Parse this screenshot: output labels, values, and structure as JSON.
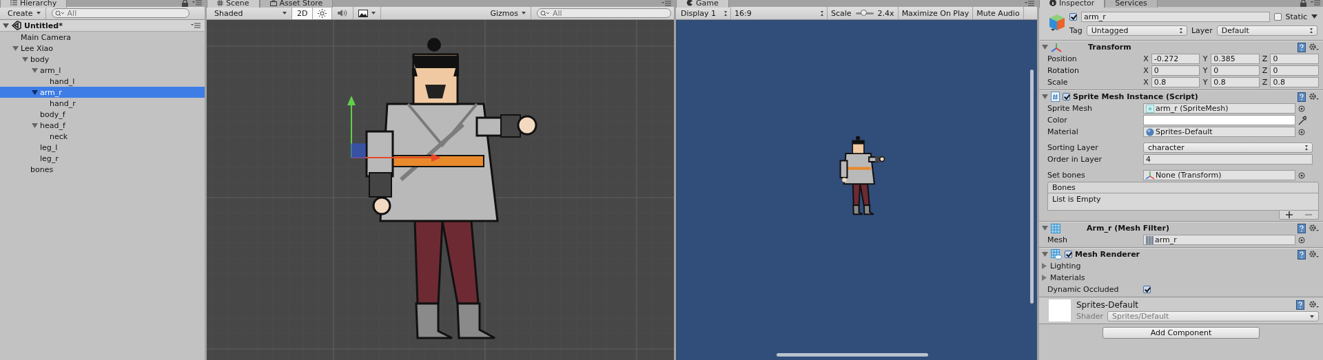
{
  "hierarchy": {
    "tab": "Hierarchy",
    "create_button": "Create",
    "search_placeholder": "All",
    "scene": {
      "name": "Untitled*",
      "expanded": true
    },
    "items": [
      {
        "name": "Main Camera",
        "selected": false
      },
      {
        "name": "Lee Xiao",
        "expanded": true,
        "selected": false,
        "children": [
          {
            "name": "body",
            "expanded": true,
            "selected": false,
            "children": [
              {
                "name": "arm_l",
                "expanded": true,
                "selected": false,
                "children": [
                  {
                    "name": "hand_l",
                    "selected": false
                  }
                ]
              },
              {
                "name": "arm_r",
                "expanded": true,
                "selected": true,
                "children": [
                  {
                    "name": "hand_r",
                    "selected": false
                  }
                ]
              },
              {
                "name": "body_f",
                "selected": false
              },
              {
                "name": "head_f",
                "expanded": true,
                "selected": false,
                "children": [
                  {
                    "name": "neck",
                    "selected": false
                  }
                ]
              },
              {
                "name": "leg_l",
                "selected": false
              },
              {
                "name": "leg_r",
                "selected": false
              }
            ]
          },
          {
            "name": "bones",
            "selected": false
          }
        ]
      }
    ]
  },
  "scene_view": {
    "tabs": [
      {
        "label": "Scene",
        "selected": true
      },
      {
        "label": "Asset Store",
        "selected": false
      }
    ],
    "shading": "Shaded",
    "mode_2d": {
      "label": "2D",
      "on": true
    },
    "lighting": {
      "on": true
    },
    "audio": {
      "on": false
    },
    "gizmos": "Gizmos",
    "search_placeholder": "All"
  },
  "game_view": {
    "tab": "Game",
    "display": "Display 1",
    "aspect": "16:9",
    "scale_label": "Scale",
    "scale": {
      "level": 0.45
    },
    "scale_reading": "2.4x",
    "maximize": "Maximize On Play",
    "mute": "Mute Audio"
  },
  "inspector": {
    "tabs": [
      {
        "label": "Inspector",
        "selected": true
      },
      {
        "label": "Services",
        "selected": false
      }
    ],
    "object": {
      "active": true,
      "name": "arm_r",
      "static_label": "Static",
      "static": false,
      "tag_label": "Tag",
      "tag": "Untagged",
      "layer_label": "Layer",
      "layer": "Default"
    },
    "components": [
      {
        "kind": "transform",
        "title": "Transform",
        "expanded": true,
        "sections": [
          [
            {
              "kind": "vector3",
              "label": "Position",
              "values": [
                {
                  "axis": "X",
                  "value": "-0.272"
                },
                {
                  "axis": "Y",
                  "value": "0.385"
                },
                {
                  "axis": "Z",
                  "value": "0"
                }
              ]
            },
            {
              "kind": "vector3",
              "label": "Rotation",
              "values": [
                {
                  "axis": "X",
                  "value": "0"
                },
                {
                  "axis": "Y",
                  "value": "0"
                },
                {
                  "axis": "Z",
                  "value": "0"
                }
              ]
            },
            {
              "kind": "vector3",
              "label": "Scale",
              "values": [
                {
                  "axis": "X",
                  "value": "0.8"
                },
                {
                  "axis": "Y",
                  "value": "0.8"
                },
                {
                  "axis": "Z",
                  "value": "0.8"
                }
              ]
            }
          ]
        ]
      },
      {
        "kind": "script",
        "title": "Sprite Mesh Instance (Script)",
        "enabled": true,
        "expanded": true,
        "sections": [
          [
            {
              "kind": "spritemesh",
              "label": "Sprite Mesh",
              "value": "arm_r (SpriteMesh)"
            },
            {
              "kind": "color",
              "label": "Color"
            },
            {
              "kind": "material",
              "label": "Material",
              "value": "Sprites-Default"
            }
          ],
          [
            {
              "kind": "dropdown",
              "label": "Sorting Layer",
              "value": "character"
            },
            {
              "kind": "text",
              "label": "Order in Layer",
              "value": "4"
            }
          ],
          [
            {
              "kind": "transform",
              "label": "Set bones",
              "value": "None (Transform)"
            },
            {
              "kind": "list",
              "label": "Bones",
              "value": "List is Empty"
            }
          ]
        ]
      },
      {
        "kind": "mesh_filter",
        "title": "Arm_r (Mesh Filter)",
        "expanded": true,
        "sections": [
          [
            {
              "kind": "mesh",
              "label": "Mesh",
              "value": "arm_r"
            }
          ]
        ]
      },
      {
        "kind": "mesh_renderer",
        "title": "Mesh Renderer",
        "enabled": true,
        "expanded": true,
        "sections": [
          [
            {
              "kind": "foldout",
              "label": "Lighting",
              "expanded": false
            },
            {
              "kind": "foldout",
              "label": "Materials",
              "expanded": false
            },
            {
              "kind": "checkbox",
              "label": "Dynamic Occluded",
              "checked": true
            }
          ]
        ]
      }
    ],
    "material": {
      "name": "Sprites-Default",
      "shader_label": "Shader",
      "shader": "Sprites/Default"
    },
    "add_component": "Add Component"
  }
}
